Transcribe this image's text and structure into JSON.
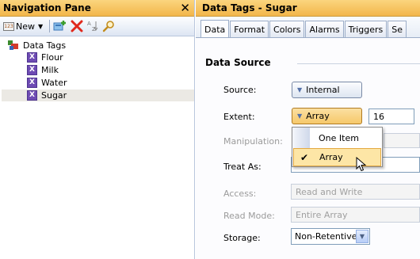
{
  "nav": {
    "title": "Navigation Pane",
    "close_glyph": "✕",
    "toolbar": {
      "badge": "123",
      "new_label": "New"
    },
    "tree": {
      "root_label": "Data Tags",
      "items": [
        {
          "label": "Flour",
          "icon_letter": "X"
        },
        {
          "label": "Milk",
          "icon_letter": "X"
        },
        {
          "label": "Water",
          "icon_letter": "X"
        },
        {
          "label": "Sugar",
          "icon_letter": "X",
          "selected": true
        }
      ]
    }
  },
  "panel": {
    "title": "Data Tags - Sugar",
    "tabs": [
      "Data",
      "Format",
      "Colors",
      "Alarms",
      "Triggers",
      "Se"
    ],
    "active_tab": "Data",
    "section_header": "Data Source",
    "source": {
      "label": "Source:",
      "value": "Internal"
    },
    "extent": {
      "label": "Extent:",
      "value": "Array",
      "size": "16"
    },
    "manipulation": {
      "label": "Manipulation:"
    },
    "treat_as": {
      "label": "Treat As:"
    },
    "access": {
      "label": "Access:",
      "value": "Read and Write"
    },
    "read_mode": {
      "label": "Read Mode:",
      "value": "Entire Array"
    },
    "storage": {
      "label": "Storage:",
      "value": "Non-Retentive"
    }
  },
  "popup": {
    "items": [
      {
        "label": "One Item",
        "checked": false
      },
      {
        "label": "Array",
        "checked": true,
        "hover": true
      }
    ],
    "check_glyph": "✔"
  },
  "colors": {
    "title_bar": "#f2b64a",
    "tag_icon": "#6e4bb3",
    "menu_hover": "#fde6a6"
  }
}
